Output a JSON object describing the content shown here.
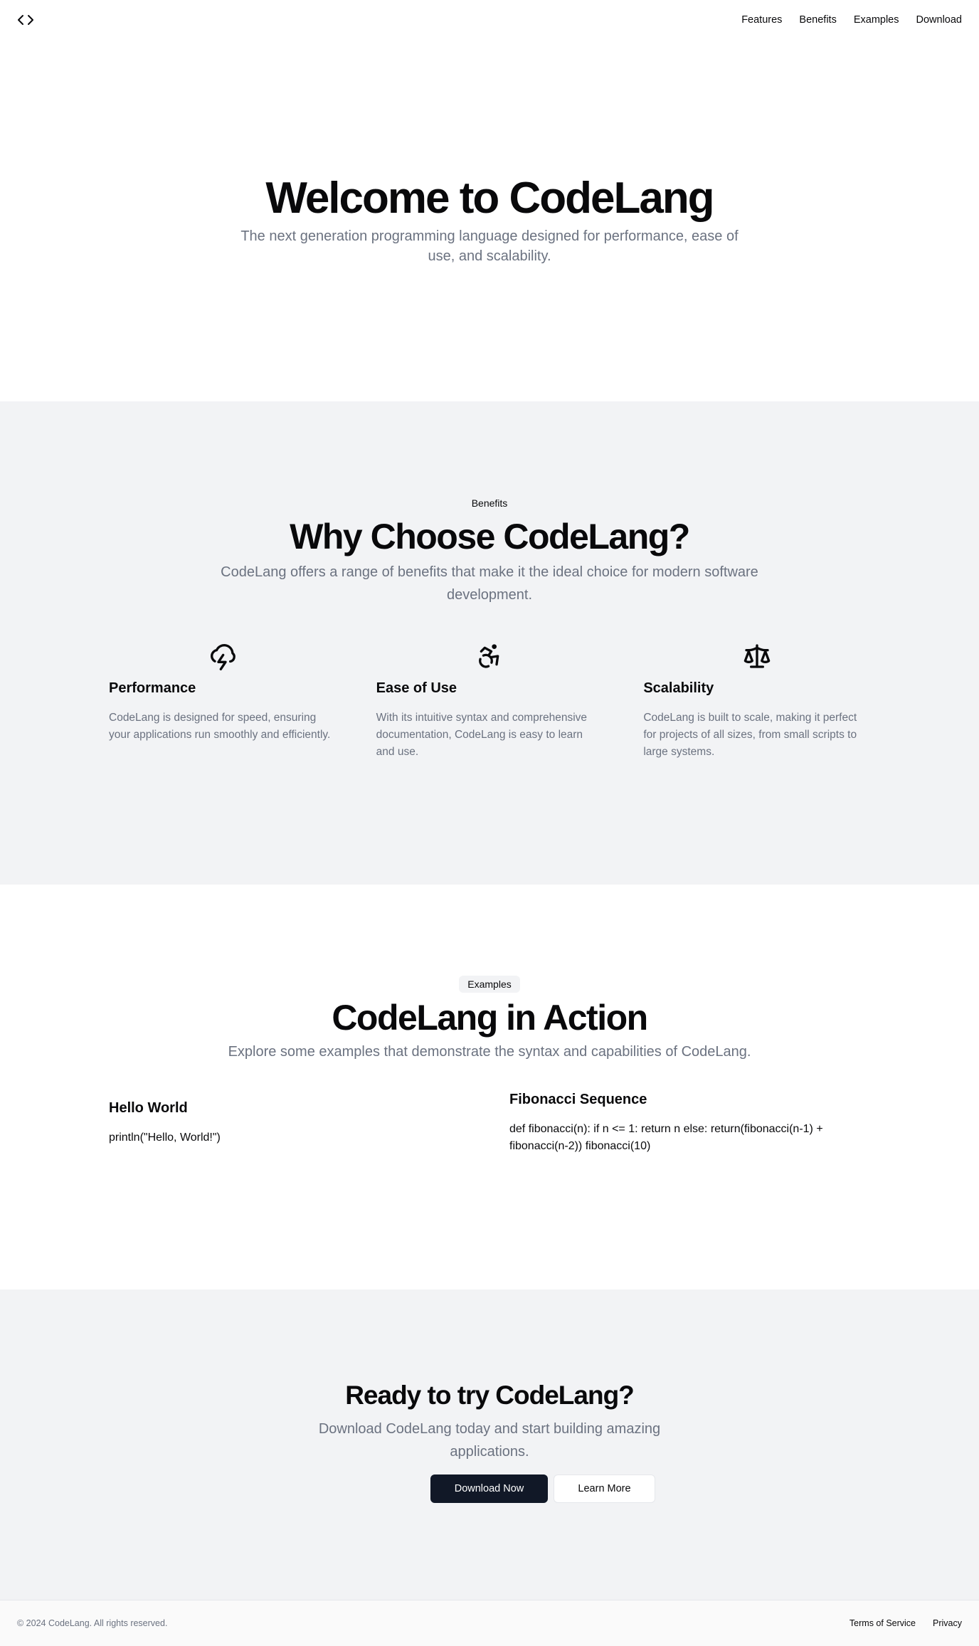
{
  "header": {
    "logo_icon": "code-brackets-icon",
    "nav": [
      "Features",
      "Benefits",
      "Examples",
      "Download"
    ]
  },
  "hero": {
    "title": "Welcome to CodeLang",
    "subtitle": "The next generation programming language designed for performance, ease of use, and scalability."
  },
  "benefits": {
    "eyebrow": "Benefits",
    "title": "Why Choose CodeLang?",
    "subtitle": "CodeLang offers a range of benefits that make it the ideal choice for modern software development.",
    "items": [
      {
        "icon": "cloud-lightning-icon",
        "title": "Performance",
        "text": "CodeLang is designed for speed, ensuring your applications run smoothly and efficiently."
      },
      {
        "icon": "accessibility-icon",
        "title": "Ease of Use",
        "text": "With its intuitive syntax and comprehensive documentation, CodeLang is easy to learn and use."
      },
      {
        "icon": "scale-icon",
        "title": "Scalability",
        "text": "CodeLang is built to scale, making it perfect for projects of all sizes, from small scripts to large systems."
      }
    ]
  },
  "examples": {
    "eyebrow": "Examples",
    "title": "CodeLang in Action",
    "subtitle": "Explore some examples that demonstrate the syntax and capabilities of CodeLang.",
    "items": [
      {
        "title": "Hello World",
        "code": "println(\"Hello, World!\")"
      },
      {
        "title": "Fibonacci Sequence",
        "code": "def fibonacci(n): if n <= 1: return n else: return(fibonacci(n-1) + fibonacci(n-2)) fibonacci(10)"
      }
    ]
  },
  "cta": {
    "title": "Ready to try CodeLang?",
    "subtitle": "Download CodeLang today and start building amazing applications.",
    "primary": "Download Now",
    "secondary": "Learn More"
  },
  "footer": {
    "copyright": "© 2024 CodeLang. All rights reserved.",
    "links": [
      "Terms of Service",
      "Privacy"
    ]
  },
  "colors": {
    "text": "#09090b",
    "muted": "#6b7280",
    "section_bg": "#f2f3f5",
    "primary_button": "#111827"
  }
}
